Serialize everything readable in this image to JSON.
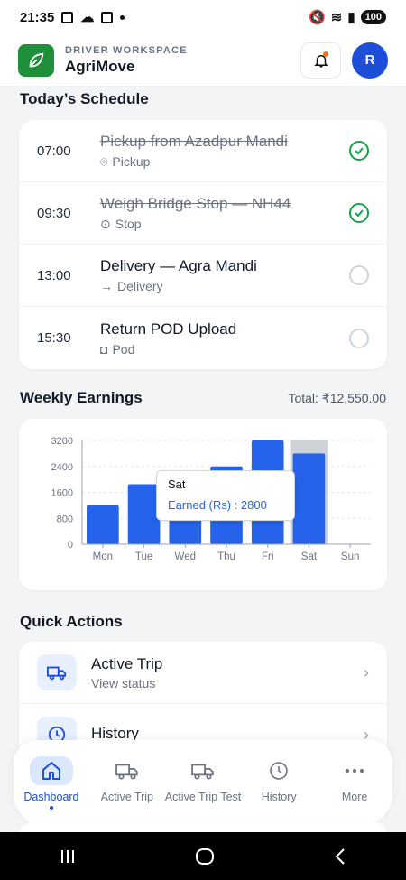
{
  "status_bar": {
    "time": "21:35",
    "battery": "100"
  },
  "header": {
    "subtitle": "DRIVER WORKSPACE",
    "title": "AgriMove",
    "avatar_initial": "R"
  },
  "schedule": {
    "title": "Today’s Schedule",
    "items": [
      {
        "time": "07:00",
        "title": "Pickup from Azadpur Mandi",
        "type": "Pickup",
        "done": true
      },
      {
        "time": "09:30",
        "title": "Weigh Bridge Stop — NH44",
        "type": "Stop",
        "done": true
      },
      {
        "time": "13:00",
        "title": "Delivery — Agra Mandi",
        "type": "Delivery",
        "done": false
      },
      {
        "time": "15:30",
        "title": "Return POD Upload",
        "type": "Pod",
        "done": false
      }
    ]
  },
  "earnings": {
    "title": "Weekly Earnings",
    "total": "Total: ₹12,550.00"
  },
  "chart_data": {
    "type": "bar",
    "categories": [
      "Mon",
      "Tue",
      "Wed",
      "Thu",
      "Fri",
      "Sat",
      "Sun"
    ],
    "series": [
      {
        "name": "Earned (Rs)",
        "values": [
          1200,
          1850,
          1000,
          2400,
          3200,
          2800,
          0
        ]
      }
    ],
    "y_ticks": [
      "0",
      "800",
      "1600",
      "2400",
      "3200"
    ],
    "ylim": [
      0,
      3200
    ],
    "grid": true,
    "highlight_category": "Sat",
    "bar_color": "#2563eb",
    "tooltip": {
      "title": "Sat",
      "label": "Earned (Rs) : 2800"
    }
  },
  "quick_actions": {
    "title": "Quick Actions",
    "items": [
      {
        "title": "Active Trip",
        "subtitle": "View status"
      },
      {
        "title": "History",
        "subtitle": ""
      }
    ]
  },
  "bottom_nav": {
    "items": [
      {
        "label": "Dashboard",
        "icon": "home-icon",
        "active": true
      },
      {
        "label": "Active Trip",
        "icon": "truck-icon",
        "active": false
      },
      {
        "label": "Active Trip Test",
        "icon": "truck-icon",
        "active": false
      },
      {
        "label": "History",
        "icon": "clock-icon",
        "active": false
      },
      {
        "label": "More",
        "icon": "more-icon",
        "active": false
      }
    ]
  },
  "colors": {
    "accent": "#1d4ed8",
    "brand_green": "#1f8f3a",
    "done_green": "#16a34a"
  }
}
